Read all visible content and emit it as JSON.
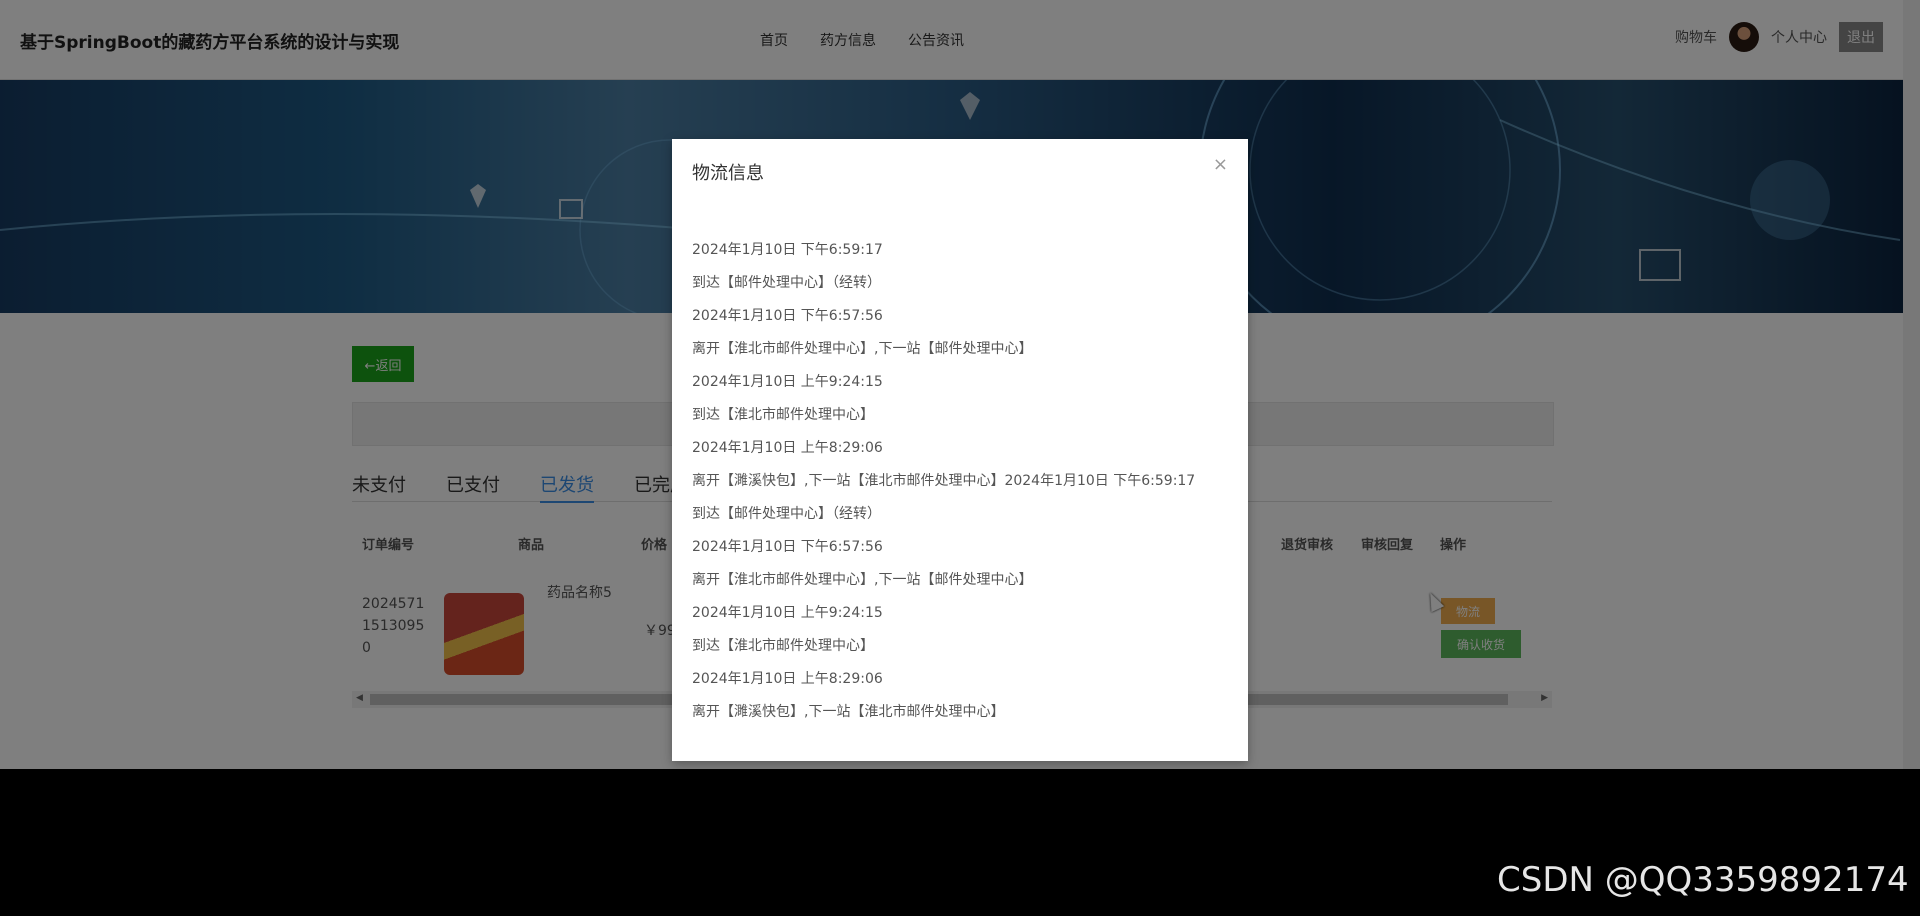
{
  "header": {
    "site_title": "基于SpringBoot的藏药方平台系统的设计与实现",
    "nav": [
      "首页",
      "药方信息",
      "公告资讯"
    ],
    "cart": "购物车",
    "profile": "个人中心",
    "logout": "退出"
  },
  "content": {
    "back_button": "←返回",
    "tabs": [
      "未支付",
      "已支付",
      "已发货",
      "已完成"
    ],
    "active_tab": "已发货",
    "table_headers": [
      "订单编号",
      "商品",
      "价格",
      "退货审核",
      "审核回复",
      "操作"
    ],
    "row": {
      "order_no_lines": [
        "2024571",
        "1513095",
        "0"
      ],
      "product_name": "药品名称5",
      "price": "￥99."
    },
    "buttons": {
      "logistics": "物流",
      "confirm_receipt": "确认收货"
    }
  },
  "modal": {
    "title": "物流信息",
    "close": "×",
    "lines": [
      "2024年1月10日 下午6:59:17",
      "到达【邮件处理中心】（经转）",
      "2024年1月10日 下午6:57:56",
      "离开【淮北市邮件处理中心】,下一站【邮件处理中心】",
      "2024年1月10日 上午9:24:15",
      "到达【淮北市邮件处理中心】",
      "2024年1月10日 上午8:29:06",
      "离开【濉溪快包】,下一站【淮北市邮件处理中心】2024年1月10日 下午6:59:17",
      "到达【邮件处理中心】（经转）",
      "2024年1月10日 下午6:57:56",
      "离开【淮北市邮件处理中心】,下一站【邮件处理中心】",
      "2024年1月10日 上午9:24:15",
      "到达【淮北市邮件处理中心】",
      "2024年1月10日 上午8:29:06",
      "离开【濉溪快包】,下一站【淮北市邮件处理中心】"
    ]
  },
  "watermark": "CSDN @QQ3359892174"
}
